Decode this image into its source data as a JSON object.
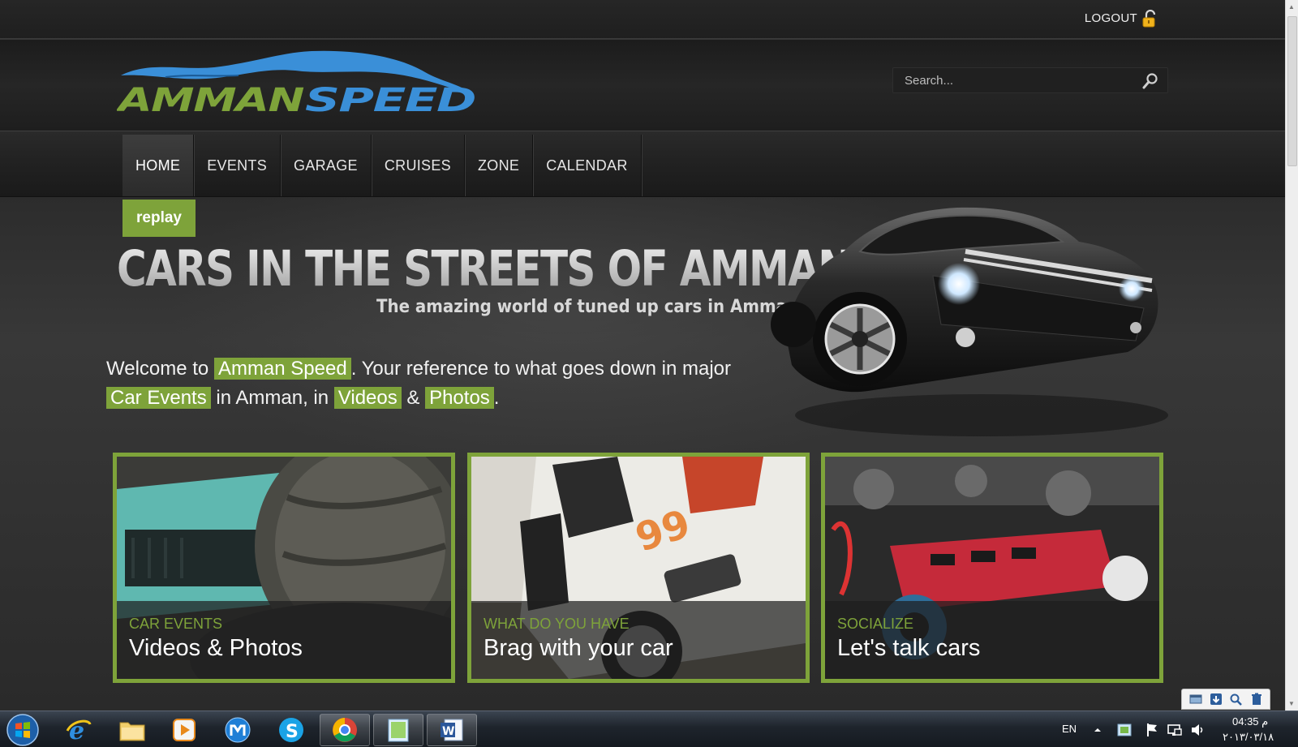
{
  "top": {
    "logout_label": "LOGOUT"
  },
  "brand": {
    "logo_word_1": "AMMAN",
    "logo_word_2": "SPEED"
  },
  "search": {
    "placeholder": "Search..."
  },
  "nav": {
    "items": [
      {
        "label": "HOME",
        "active": true
      },
      {
        "label": "EVENTS"
      },
      {
        "label": "GARAGE"
      },
      {
        "label": "CRUISES"
      },
      {
        "label": "ZONE"
      },
      {
        "label": "CALENDAR"
      }
    ]
  },
  "hero": {
    "tag": "replay",
    "title": "CARS IN THE STREETS OF AMMAN",
    "subtitle": "The amazing world of tuned up cars in Amman"
  },
  "welcome": {
    "part1": "Welcome to ",
    "link1": "Amman Speed",
    "part2": ". Your reference to what goes down in major ",
    "link2": "Car Events",
    "part3": " in Amman, in ",
    "link3": "Videos",
    "part4": " & ",
    "link4": "Photos",
    "part5": "."
  },
  "cards": [
    {
      "kicker": "CAR EVENTS",
      "headline": "Videos & Photos"
    },
    {
      "kicker": "WHAT DO YOU HAVE",
      "headline": "Brag with your car",
      "car_number": "99"
    },
    {
      "kicker": "SOCIALIZE",
      "headline": "Let's talk cars"
    }
  ],
  "taskbar": {
    "apps": [
      "internet-explorer",
      "file-explorer",
      "media-player",
      "maxthon",
      "skype",
      "chrome",
      "notepad",
      "word"
    ],
    "word_letter": "W",
    "lang": "EN",
    "time": "04:35 م",
    "date": "٢٠١٣/٠٣/١٨"
  },
  "colors": {
    "accent": "#7ea33a",
    "logo_blue": "#3a8fd8"
  }
}
